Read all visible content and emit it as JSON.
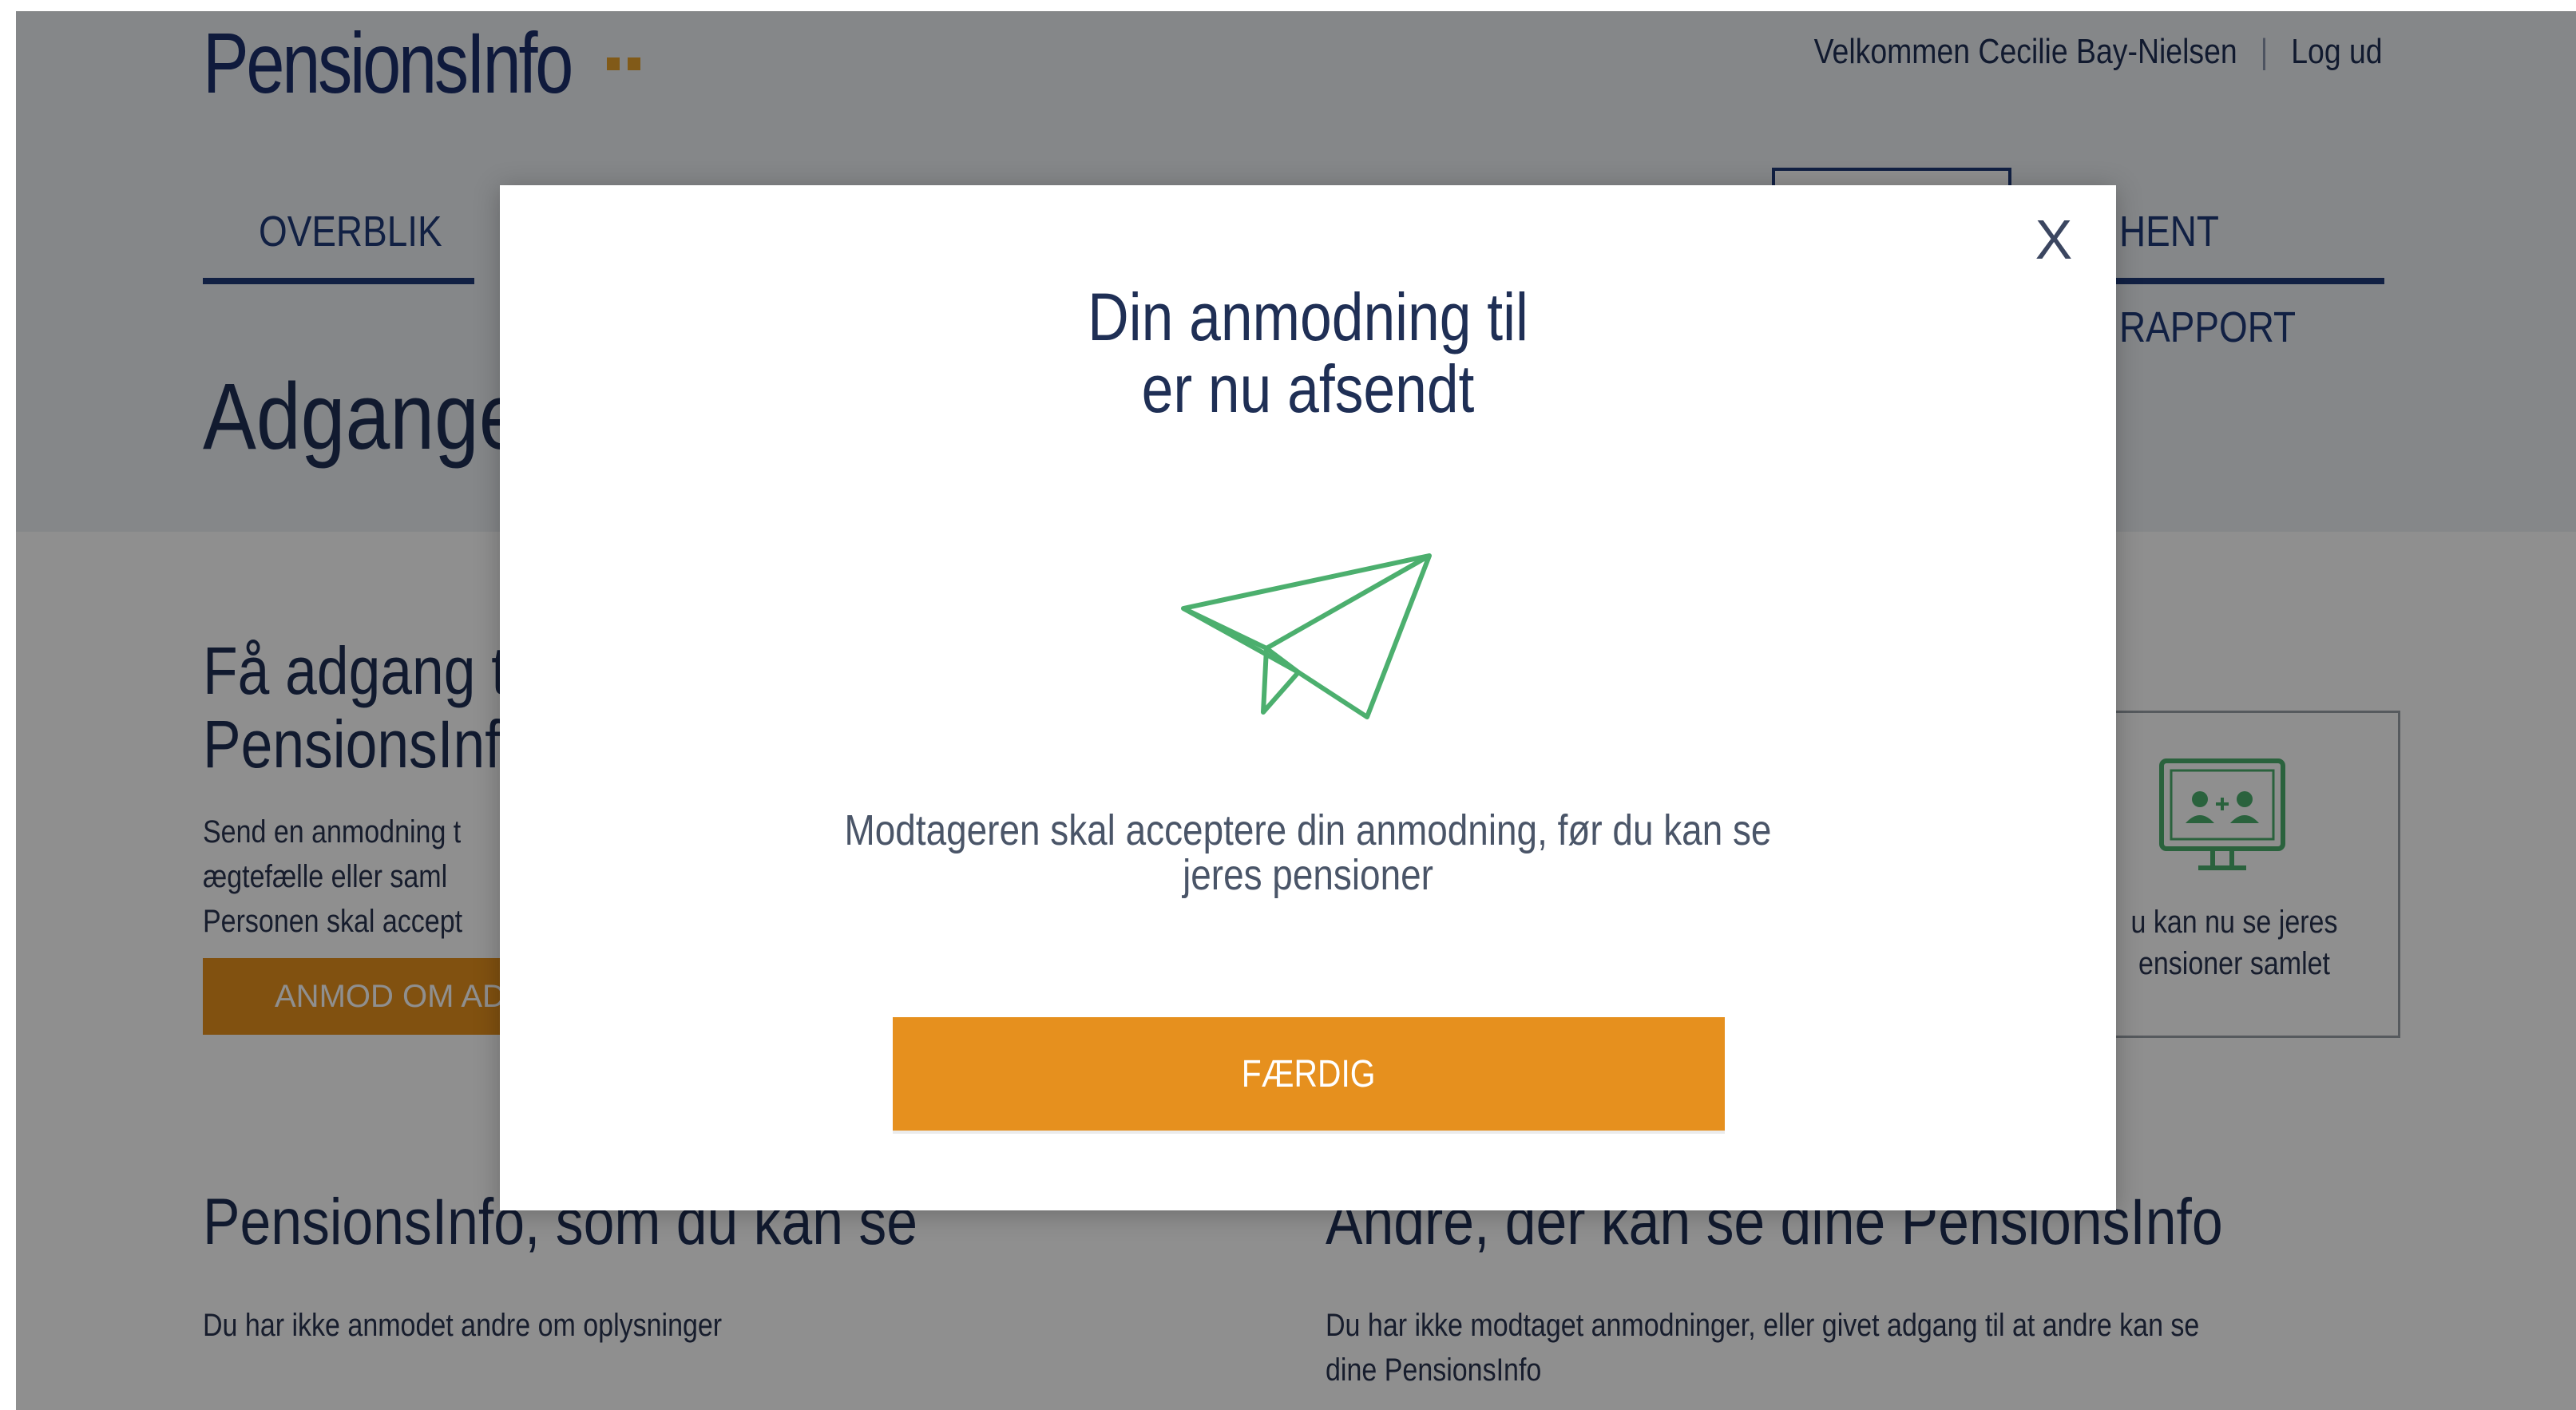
{
  "brand": {
    "logo_text": "PensionsInfo",
    "accent_color": "#e6a02b",
    "primary_color": "#1f3a78"
  },
  "header": {
    "welcome": "Velkommen Cecilie Bay-Nielsen",
    "logout": "Log ud"
  },
  "nav": {
    "tabs": [
      {
        "label": "OVERBLIK"
      },
      {
        "label": "HENT RAPPORT"
      }
    ]
  },
  "page": {
    "title": "Adgange"
  },
  "section": {
    "title": "Få adgang t\nPensionsInf",
    "text": "Send en anmodning t\nægtefælle eller saml\nPersonen skal accept",
    "button": "ANMOD OM AD"
  },
  "info_card": {
    "icon": "monitor-couple-icon",
    "text": "u kan nu se jeres\nensioner samlet"
  },
  "columns": [
    {
      "title": "PensionsInfo, som du kan se",
      "text": "Du har ikke anmodet andre om oplysninger"
    },
    {
      "title": "Andre, der kan se dine PensionsInfo",
      "text": "Du har ikke modtaget anmodninger, eller givet adgang til at andre kan se\ndine PensionsInfo"
    }
  ],
  "modal": {
    "close": "X",
    "title": "Din anmodning til\ner nu afsendt",
    "icon": "paper-plane-icon",
    "icon_color": "#4caf6e",
    "message": "Modtageren skal acceptere din anmodning, før du kan se\njeres pensioner",
    "button": "FÆRDIG",
    "button_color": "#e6901e"
  }
}
